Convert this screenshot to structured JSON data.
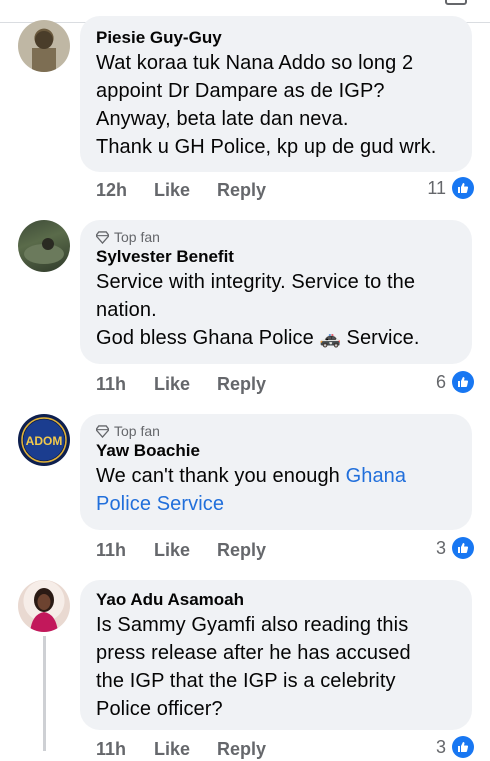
{
  "comments": [
    {
      "author": "Piesie Guy-Guy",
      "badge": "",
      "lines": [
        "Wat koraa tuk Nana Addo so long 2",
        "appoint Dr Dampare as de IGP?",
        "Anyway, beta late dan neva.",
        "Thank u GH Police, kp up de gud wrk."
      ],
      "time": "12h",
      "like": "Like",
      "reply": "Reply",
      "reactions": "11"
    },
    {
      "author": "Sylvester Benefit",
      "badge": "Top fan",
      "lines": [
        "Service with integrity. Service to the",
        "nation.",
        "God bless Ghana Police",
        "Service."
      ],
      "emoji": "🚓",
      "time": "11h",
      "like": "Like",
      "reply": "Reply",
      "reactions": "6"
    },
    {
      "author": "Yaw Boachie",
      "badge": "Top fan",
      "text_plain": "We can't thank you enough ",
      "link_line1": "Ghana",
      "link_line2": "Police Service",
      "time": "11h",
      "like": "Like",
      "reply": "Reply",
      "reactions": "3",
      "avatar_text": "ADOM"
    },
    {
      "author": "Yao Adu Asamoah",
      "badge": "",
      "lines": [
        "Is Sammy Gyamfi also reading this",
        "press release after he has accused",
        "the IGP that the IGP is a celebrity",
        "Police officer?"
      ],
      "time": "11h",
      "like": "Like",
      "reply": "Reply",
      "reactions": "3"
    }
  ],
  "colors": {
    "like_blue": "#1877f2",
    "link_blue": "#216fdb",
    "bubble": "#f0f2f5",
    "meta_gray": "#65676b"
  },
  "icons": [
    "diamond-icon",
    "like-thumb-icon",
    "police-car-emoji"
  ]
}
